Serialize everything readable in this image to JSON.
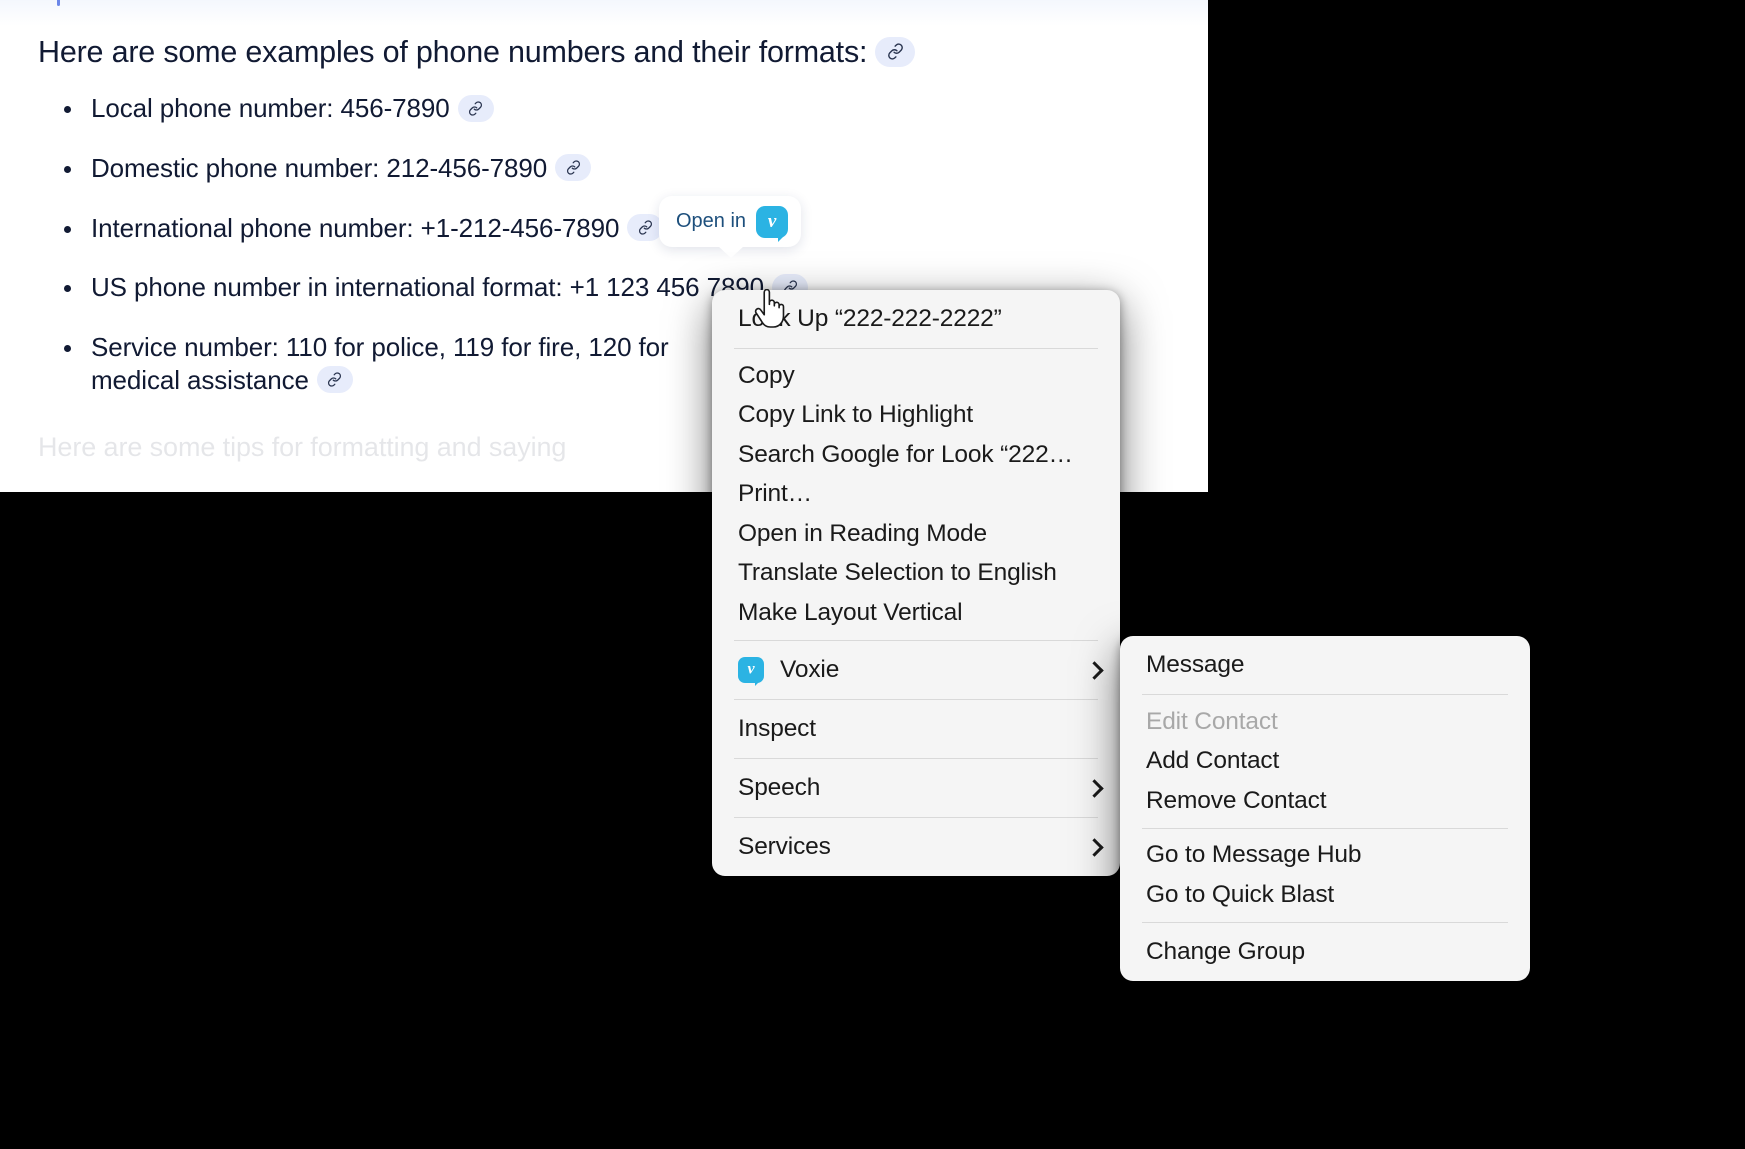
{
  "document": {
    "heading": "Here are some examples of phone numbers and their formats:",
    "bullets": [
      "Local phone number: 456-7890",
      "Domestic phone number: 212-456-7890",
      "International phone number: +1-212-456-7890",
      "US phone number in international format: +1 123 456 7890",
      "Service number: 110 for police, 119 for fire, 120 for medical assistance"
    ],
    "faded_paragraph": "Here are some tips for formatting and saying"
  },
  "tooltip": {
    "label": "Open in",
    "app_name": "Voxie",
    "app_mark": "v",
    "app_color": "#2bb3e3"
  },
  "context_menu": {
    "groups": [
      {
        "items": [
          {
            "label": "Look Up “222-222-2222”",
            "type": "item",
            "disabled": false
          }
        ]
      },
      {
        "items": [
          {
            "label": "Copy",
            "type": "item",
            "disabled": false
          },
          {
            "label": "Copy Link to Highlight",
            "type": "item",
            "disabled": false
          },
          {
            "label": "Search Google for Look “222…",
            "type": "item",
            "disabled": false
          },
          {
            "label": "Print…",
            "type": "item",
            "disabled": false
          },
          {
            "label": "Open in Reading Mode",
            "type": "item",
            "disabled": false
          },
          {
            "label": "Translate Selection to English",
            "type": "item",
            "disabled": false
          },
          {
            "label": "Make Layout Vertical",
            "type": "item",
            "disabled": false
          }
        ]
      },
      {
        "items": [
          {
            "label": "Voxie",
            "type": "submenu",
            "icon": "voxie-app-icon",
            "disabled": false
          }
        ]
      },
      {
        "items": [
          {
            "label": "Inspect",
            "type": "item",
            "disabled": false
          }
        ]
      },
      {
        "items": [
          {
            "label": "Speech",
            "type": "submenu",
            "disabled": false
          }
        ]
      },
      {
        "items": [
          {
            "label": "Services",
            "type": "submenu",
            "disabled": false
          }
        ]
      }
    ]
  },
  "submenu": {
    "groups": [
      {
        "items": [
          {
            "label": "Message",
            "disabled": false
          }
        ]
      },
      {
        "items": [
          {
            "label": "Edit Contact",
            "disabled": true
          },
          {
            "label": "Add Contact",
            "disabled": false
          },
          {
            "label": "Remove Contact",
            "disabled": false
          }
        ]
      },
      {
        "items": [
          {
            "label": "Go to Message Hub",
            "disabled": false
          },
          {
            "label": "Go to Quick Blast",
            "disabled": false
          }
        ]
      },
      {
        "items": [
          {
            "label": "Change Group",
            "disabled": false
          }
        ]
      }
    ]
  },
  "colors": {
    "document_text": "#111a33",
    "link_chip_bg": "#e7ecfb",
    "menu_bg": "#f5f5f5",
    "accent": "#2bb3e3",
    "tooltip_text": "#1d4f7c"
  }
}
